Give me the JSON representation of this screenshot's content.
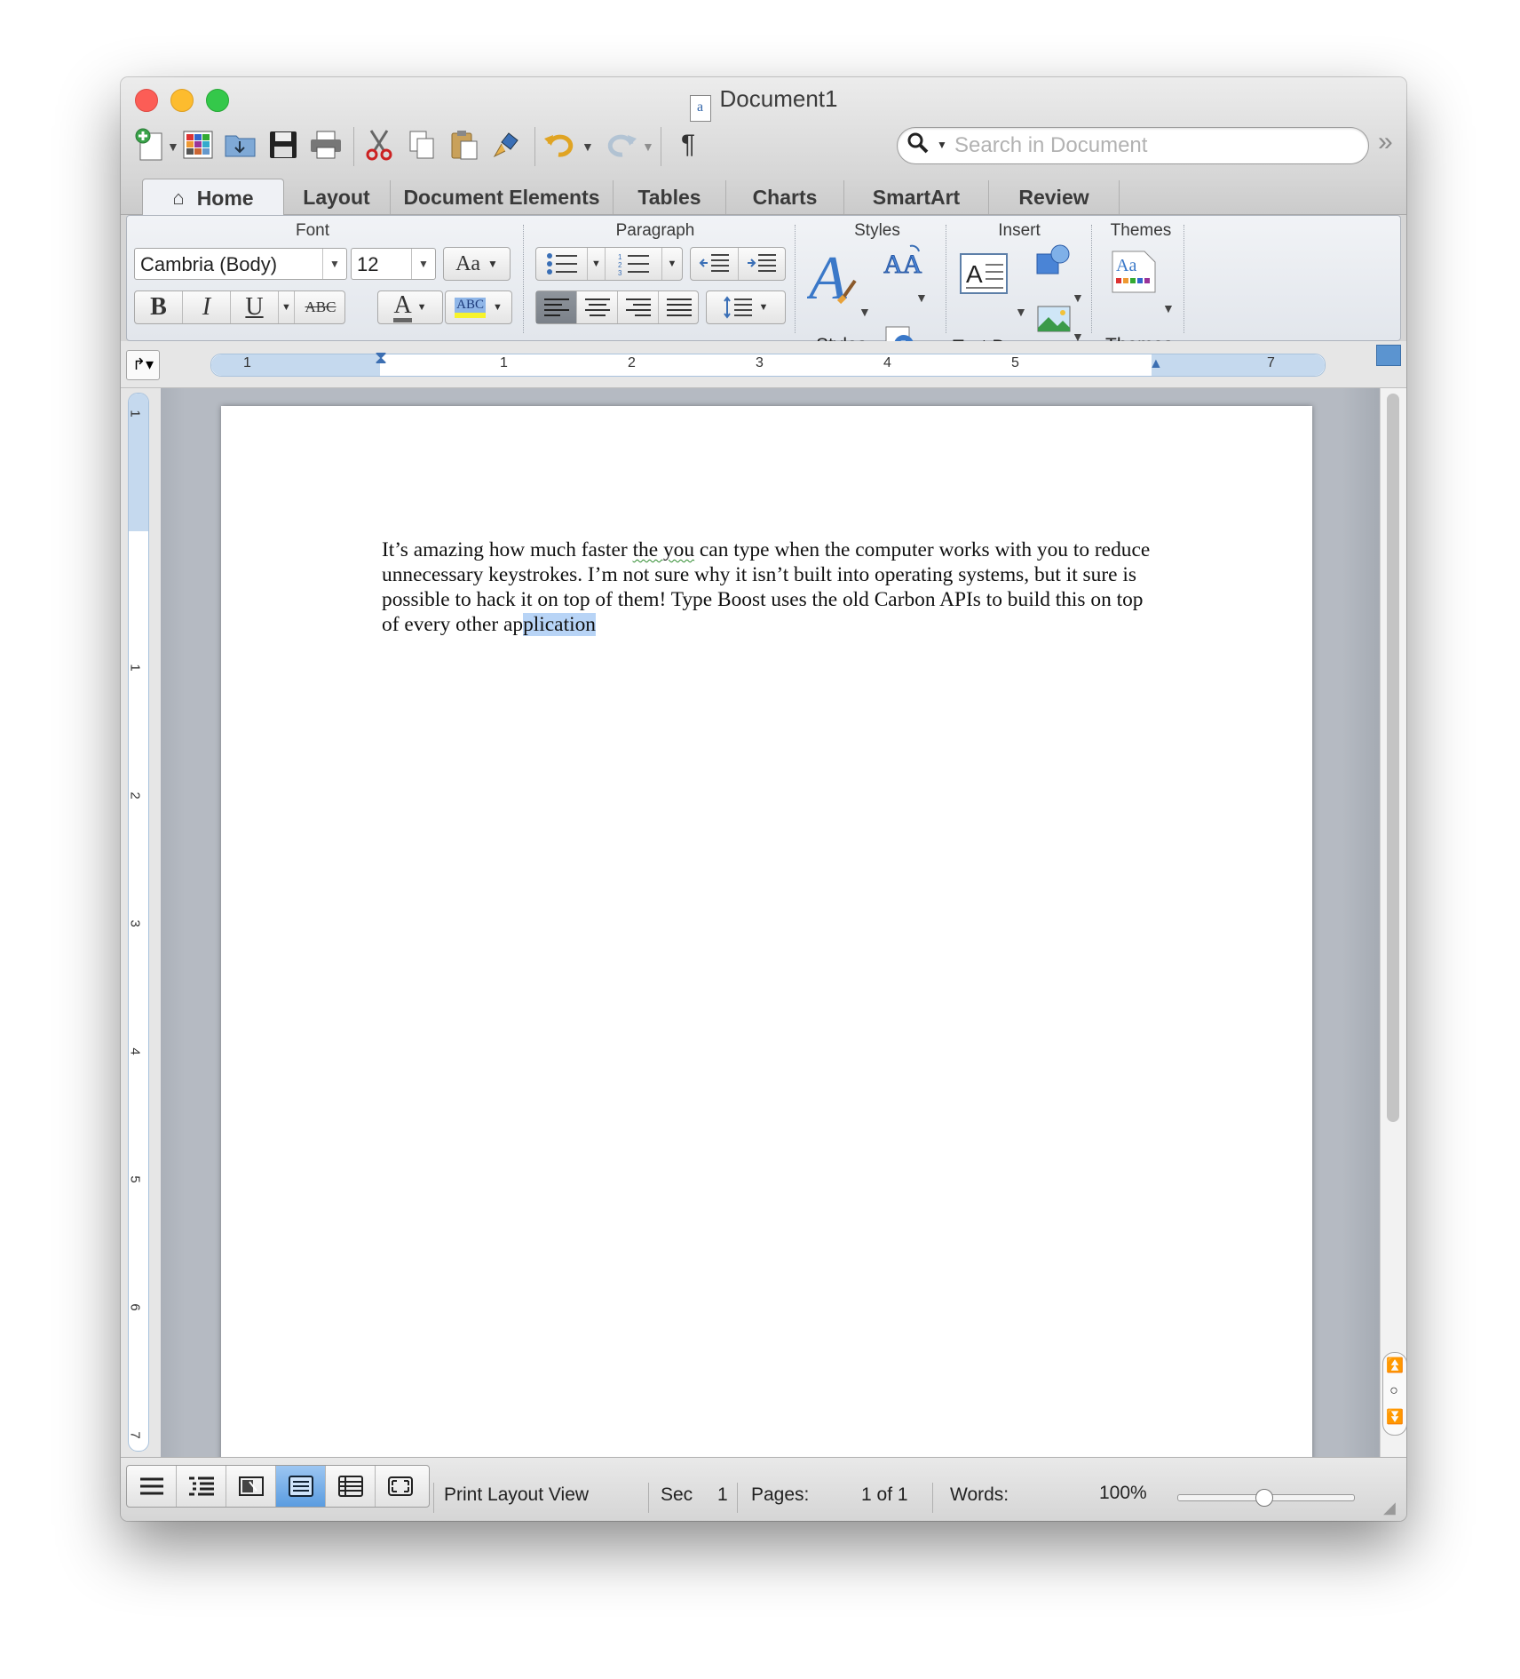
{
  "window": {
    "title": "Document1"
  },
  "toolbar": {
    "search_placeholder": "Search in Document",
    "pilcrow": "¶"
  },
  "tabs": [
    {
      "label": "Home",
      "active": true
    },
    {
      "label": "Layout"
    },
    {
      "label": "Document Elements"
    },
    {
      "label": "Tables"
    },
    {
      "label": "Charts"
    },
    {
      "label": "SmartArt"
    },
    {
      "label": "Review"
    }
  ],
  "ribbon": {
    "font": {
      "group_title": "Font",
      "font_name": "Cambria (Body)",
      "font_size": "12",
      "bold": "B",
      "italic": "I",
      "underline": "U",
      "strikethrough": "ABC",
      "font_color_label": "A",
      "highlight_label": "ABC",
      "change_case_label": "Aa"
    },
    "paragraph": {
      "group_title": "Paragraph"
    },
    "styles": {
      "group_title": "Styles",
      "styles_label": "Styles"
    },
    "insert": {
      "group_title": "Insert",
      "text_box_label": "Text Box"
    },
    "themes": {
      "group_title": "Themes",
      "themes_label": "Themes",
      "themes_icon_text": "Aa"
    }
  },
  "ruler": {
    "labels": [
      "1",
      "1",
      "2",
      "3",
      "4",
      "5",
      "7"
    ],
    "vertical_labels": [
      "1",
      "1",
      "2",
      "3",
      "4",
      "5",
      "6",
      "7"
    ]
  },
  "document": {
    "text_before_squiggle": "It’s amazing how much faster ",
    "squiggle_text": "the you",
    "text_after_squiggle": " can type when the computer works with you to reduce unnecessary keystrokes. I’m not sure why it isn’t built into operating systems, but it sure is possible to hack it on top of them!  Type Boost uses the old Carbon APIs to build this on top of every other ap",
    "selected_text": "plication "
  },
  "statusbar": {
    "view_name": "Print Layout View",
    "sec_label": "Sec",
    "sec_value": "1",
    "pages_label": "Pages:",
    "pages_value": "1 of 1",
    "words_label": "Words:",
    "zoom": "100%"
  },
  "colors": {
    "close": "#fc5d56",
    "minimize": "#fdbc2e",
    "maximize": "#34c84a",
    "selection": "#b8d4f6",
    "active_view": "#5a9ce0"
  }
}
